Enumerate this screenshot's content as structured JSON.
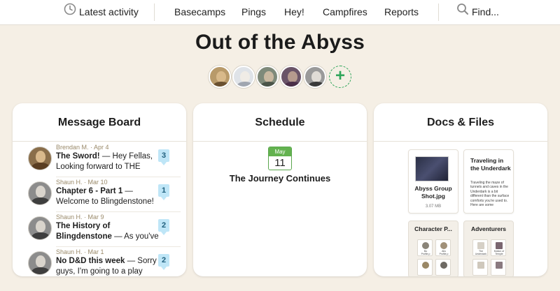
{
  "nav": {
    "latest_activity": "Latest activity",
    "basecamps": "Basecamps",
    "pings": "Pings",
    "hey": "Hey!",
    "campfires": "Campfires",
    "reports": "Reports",
    "find": "Find..."
  },
  "project": {
    "title": "Out of the Abyss",
    "add_people_label": "+"
  },
  "message_board": {
    "heading": "Message Board",
    "messages": [
      {
        "meta": "Brendan M. · Apr 4",
        "subject": "The Sword!",
        "excerpt": " — Hey Fellas, Looking forward to THE",
        "comments": "3"
      },
      {
        "meta": "Shaun H. · Mar 10",
        "subject": "Chapter 6 - Part 1",
        "excerpt": " — Welcome to Blingdenstone!",
        "comments": "1"
      },
      {
        "meta": "Shaun H. · Mar 9",
        "subject": "The History of Blingdenstone",
        "excerpt": " — As you've",
        "comments": "2"
      },
      {
        "meta": "Shaun H. · Mar 1",
        "subject": "No D&D this week",
        "excerpt": " — Sorry guys, I'm going to a play",
        "comments": "2"
      }
    ]
  },
  "schedule": {
    "heading": "Schedule",
    "month": "May",
    "day": "11",
    "event": "The Journey Continues"
  },
  "docs": {
    "heading": "Docs & Files",
    "file_name": "Abyss Group Shot.jpg",
    "file_size": "3.07 MB",
    "doc_title": "Traveling in the Underdark",
    "doc_body": "Traveling the maze of tunnels and caves in the Underdark is a bit different than the surface comforts you're used to. Here are some",
    "folder1": "Character P...",
    "folder2": "Adventurers",
    "folder1_items": [
      "Bo Profile.p",
      "Allo Profile.p",
      "",
      ""
    ],
    "folder2_items": [
      "The Underdark",
      "Motion of Temple",
      "",
      ""
    ]
  },
  "colors": {
    "background": "#f5efe5",
    "accent_green": "#2fa55a",
    "comment_bubble": "#bfe6f7",
    "meta_text": "#9a8a6a"
  }
}
